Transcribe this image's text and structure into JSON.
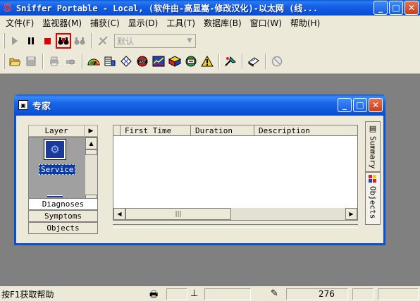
{
  "window": {
    "title": "Sniffer Portable - Local, (软件由-高显嵩-修改汉化)-以太网 (线...",
    "app_icon": "S",
    "btn_minimize": "_",
    "btn_maximize": "□",
    "btn_close": "✕"
  },
  "menu": [
    {
      "label": "文件(F)"
    },
    {
      "label": "监视器(M)"
    },
    {
      "label": "捕获(C)"
    },
    {
      "label": "显示(D)"
    },
    {
      "label": "工具(T)"
    },
    {
      "label": "数据库(B)"
    },
    {
      "label": "窗口(W)"
    },
    {
      "label": "帮助(H)"
    }
  ],
  "toolbar": {
    "profile_combo": "默认",
    "combo_arrow": "▼"
  },
  "child_window": {
    "title": "专家",
    "btn_minimize": "_",
    "btn_maximize": "□",
    "btn_close": "✕"
  },
  "layer_panel": {
    "header": "Layer",
    "header_arrow": "▶",
    "selected_item": "Service",
    "tabs": [
      "Diagnoses",
      "Symptoms",
      "Objects"
    ]
  },
  "grid": {
    "columns": [
      "First Time",
      "Duration",
      "Description"
    ],
    "scroll_left": "◀",
    "scroll_right": "▶",
    "thumb_grip": "|||"
  },
  "side_tabs": {
    "summary": "Summary",
    "objects": "Objects"
  },
  "status_bar": {
    "help_text": "按F1获取帮助",
    "value": "276"
  },
  "colors": {
    "titlebar": "#0a57dc",
    "workspace": "#808080",
    "face": "#ece9d8",
    "selection": "#0a3aa8",
    "record_highlight": "#e00000"
  }
}
